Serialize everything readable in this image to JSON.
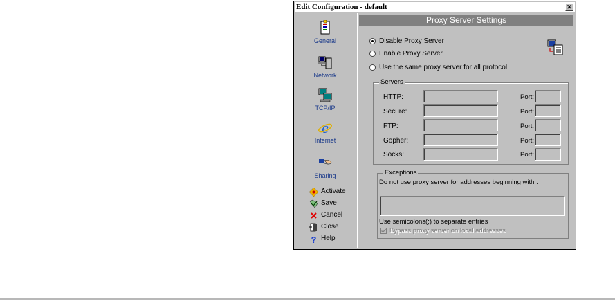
{
  "window": {
    "title": "Edit Configuration - default",
    "close_glyph": "✕"
  },
  "nav": {
    "items": [
      {
        "label": "General",
        "icon": "general-icon"
      },
      {
        "label": "Network",
        "icon": "network-icon"
      },
      {
        "label": "TCP/IP",
        "icon": "tcpip-icon"
      },
      {
        "label": "Internet",
        "icon": "internet-explorer-icon"
      },
      {
        "label": "Sharing",
        "icon": "sharing-hand-icon"
      }
    ]
  },
  "actions": [
    {
      "label": "Activate",
      "icon": "activate-icon"
    },
    {
      "label": "Save",
      "icon": "save-icon"
    },
    {
      "label": "Cancel",
      "icon": "cancel-x-icon"
    },
    {
      "label": "Close",
      "icon": "close-door-icon"
    },
    {
      "label": "Help",
      "icon": "help-question-icon"
    }
  ],
  "panel": {
    "header": "Proxy Server Settings",
    "radios": [
      {
        "label": "Disable Proxy Server",
        "selected": true
      },
      {
        "label": "Enable Proxy Server",
        "selected": false
      },
      {
        "label": "Use the same proxy server for all protocol",
        "selected": false
      }
    ],
    "servers": {
      "title": "Servers",
      "port_label": "Port:",
      "rows": [
        {
          "label": "HTTP:",
          "value": "",
          "port": ""
        },
        {
          "label": "Secure:",
          "value": "",
          "port": ""
        },
        {
          "label": "FTP:",
          "value": "",
          "port": ""
        },
        {
          "label": "Gopher:",
          "value": "",
          "port": ""
        },
        {
          "label": "Socks:",
          "value": "",
          "port": ""
        }
      ]
    },
    "exceptions": {
      "title": "Exceptions",
      "description": "Do not use proxy server for addresses beginning with :",
      "value": "",
      "hint": "Use semicolons(;) to separate entries",
      "bypass_label": "Bypass proxy server on local addresses",
      "bypass_checked": true
    }
  },
  "colors": {
    "window_bg": "#c0c0c0",
    "header_bg": "#808080",
    "nav_label": "#1b3a8a"
  }
}
